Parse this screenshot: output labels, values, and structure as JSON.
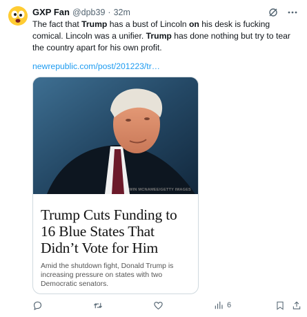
{
  "post": {
    "author_name": "GXP Fan",
    "handle": "@dpb39",
    "dot": "·",
    "time": "32m",
    "text_segments": [
      {
        "t": "The fact that ",
        "b": false
      },
      {
        "t": "Trump",
        "b": true
      },
      {
        "t": " has a bust of Lincoln ",
        "b": false
      },
      {
        "t": "on",
        "b": true
      },
      {
        "t": " his desk is fucking comical. Lincoln was a unifier. ",
        "b": false
      },
      {
        "t": "Trump",
        "b": true
      },
      {
        "t": " has done nothing but try to tear the country apart for his own profit.",
        "b": false
      }
    ],
    "link": "newrepublic.com/post/201223/tr…"
  },
  "card": {
    "photo_credit": "WIN MCNAMEE/GETTY IMAGES",
    "headline": "Trump Cuts Funding to 16 Blue States That Didn’t Vote for Him",
    "subtext": "Amid the shutdown fight, Donald Trump is increasing pressure on states with two Democratic senators."
  },
  "actions": {
    "views_count": "6"
  },
  "icons": {
    "avatar": "emoji-face-avatar",
    "grok": "grok-icon",
    "more": "more-icon",
    "reply": "reply-icon",
    "repost": "repost-icon",
    "like": "like-icon",
    "views": "views-icon",
    "bookmark": "bookmark-icon",
    "share": "share-icon"
  },
  "colors": {
    "link": "#1d9bf0",
    "text": "#0f1419",
    "muted": "#536471",
    "border": "#cfd9de"
  }
}
